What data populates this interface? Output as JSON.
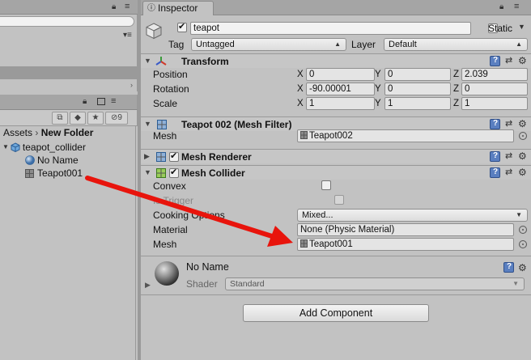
{
  "left_top": {
    "lock_icon": "lock-icon",
    "menu_icon": "menu-icon"
  },
  "project": {
    "toolbar_count": "9",
    "breadcrumb": {
      "root": "Assets",
      "sep": "›",
      "current": "New Folder"
    },
    "tree": [
      {
        "label": "teapot_collider",
        "icon": "prefab-icon",
        "expanded": true
      },
      {
        "label": "No Name",
        "icon": "material-sphere-icon"
      },
      {
        "label": "Teapot001",
        "icon": "mesh-icon"
      }
    ]
  },
  "inspector": {
    "tab_label": "Inspector",
    "object": {
      "name": "teapot",
      "active": true,
      "static_label": "Static",
      "tag_label": "Tag",
      "tag_value": "Untagged",
      "layer_label": "Layer",
      "layer_value": "Default"
    },
    "transform": {
      "title": "Transform",
      "position_label": "Position",
      "rotation_label": "Rotation",
      "scale_label": "Scale",
      "position": {
        "x": "0",
        "y": "0",
        "z": "2.039"
      },
      "rotation": {
        "x": "-90.00001",
        "y": "0",
        "z": "0"
      },
      "scale": {
        "x": "1",
        "y": "1",
        "z": "1"
      },
      "axis_x": "X",
      "axis_y": "Y",
      "axis_z": "Z"
    },
    "mesh_filter": {
      "title": "Teapot 002 (Mesh Filter)",
      "mesh_label": "Mesh",
      "mesh_value": "Teapot002"
    },
    "mesh_renderer": {
      "title": "Mesh Renderer",
      "enabled": true
    },
    "mesh_collider": {
      "title": "Mesh Collider",
      "enabled": true,
      "convex_label": "Convex",
      "trigger_label": "Is Trigger",
      "cooking_label": "Cooking Options",
      "cooking_value": "Mixed...",
      "material_label": "Material",
      "material_value": "None (Physic Material)",
      "mesh_label": "Mesh",
      "mesh_value": "Teapot001"
    },
    "material": {
      "name": "No Name",
      "shader_label": "Shader",
      "shader_value": "Standard"
    },
    "add_component": "Add Component"
  },
  "colors": {
    "arrow": "#e8140c",
    "panel_bg": "#c2c2c2",
    "tab_bar": "#a5a5a5"
  }
}
